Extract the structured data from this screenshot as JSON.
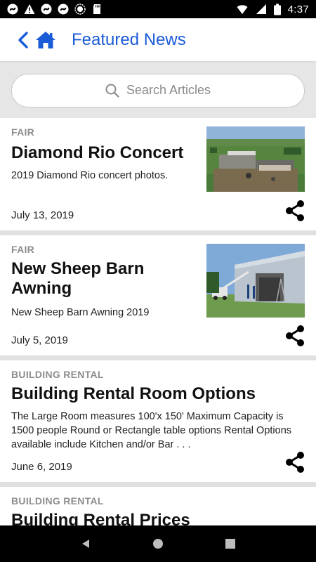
{
  "status_bar": {
    "time": "4:37",
    "icons": [
      "sync-icon",
      "alert-icon",
      "sync-icon",
      "sync-icon",
      "circle-icon",
      "sd-card-icon",
      "wifi-icon",
      "signal-icon",
      "battery-icon"
    ]
  },
  "app_bar": {
    "title": "Featured News",
    "accent_color": "#1a5bd8"
  },
  "search": {
    "placeholder": "Search Articles"
  },
  "articles": [
    {
      "category": "FAIR",
      "title": "Diamond Rio Concert",
      "summary": "2019 Diamond Rio concert photos.",
      "date": "July 13, 2019",
      "has_image": true,
      "image_subject": "aerial-fairground-concert"
    },
    {
      "category": "FAIR",
      "title": "New Sheep Barn Awning",
      "summary": "New Sheep Barn Awning 2019",
      "date": "July 5, 2019",
      "has_image": true,
      "image_subject": "barn-construction"
    },
    {
      "category": "BUILDING RENTAL",
      "title": "Building Rental Room Options",
      "summary": "The Large Room measures 100'x 150' Maximum Capacity is 1500 people Round or Rectangle table options Rental Options available include Kitchen and/or Bar . . .",
      "date": "June 6, 2019",
      "has_image": false
    },
    {
      "category": "BUILDING RENTAL",
      "title": "Building Rental Prices",
      "has_image": false
    }
  ]
}
